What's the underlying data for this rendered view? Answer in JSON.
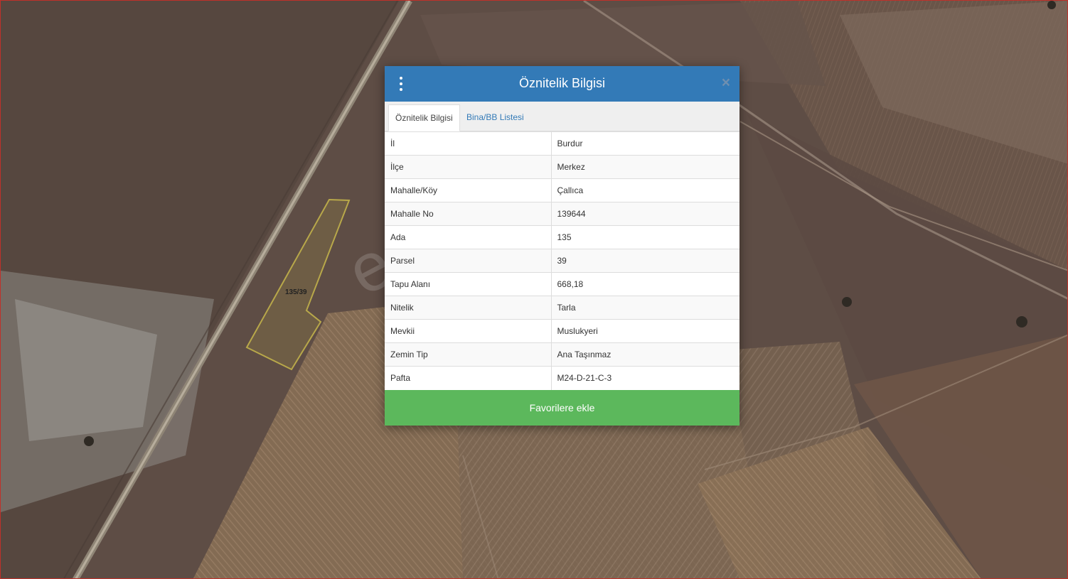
{
  "map": {
    "parcel_label": "135/39",
    "watermark": "emlakjet.com"
  },
  "dialog": {
    "title": "Öznitelik Bilgisi",
    "menu_icon": "vertical-ellipsis-icon",
    "close_icon": "close-icon",
    "close_glyph": "×",
    "tabs": [
      {
        "label": "Öznitelik Bilgisi",
        "active": true
      },
      {
        "label": "Bina/BB Listesi",
        "active": false
      }
    ],
    "rows": [
      {
        "key": "İl",
        "value": "Burdur"
      },
      {
        "key": "İlçe",
        "value": "Merkez"
      },
      {
        "key": "Mahalle/Köy",
        "value": "Çallıca"
      },
      {
        "key": "Mahalle No",
        "value": "139644"
      },
      {
        "key": "Ada",
        "value": "135"
      },
      {
        "key": "Parsel",
        "value": "39"
      },
      {
        "key": "Tapu Alanı",
        "value": "668,18"
      },
      {
        "key": "Nitelik",
        "value": "Tarla"
      },
      {
        "key": "Mevkii",
        "value": "Muslukyeri"
      },
      {
        "key": "Zemin Tip",
        "value": "Ana Taşınmaz"
      },
      {
        "key": "Pafta",
        "value": "M24-D-21-C-3"
      }
    ],
    "favorite_button": "Favorilere ekle"
  },
  "colors": {
    "header": "#337ab7",
    "button": "#5cb85c",
    "parcel_outline": "#b8a84a"
  }
}
